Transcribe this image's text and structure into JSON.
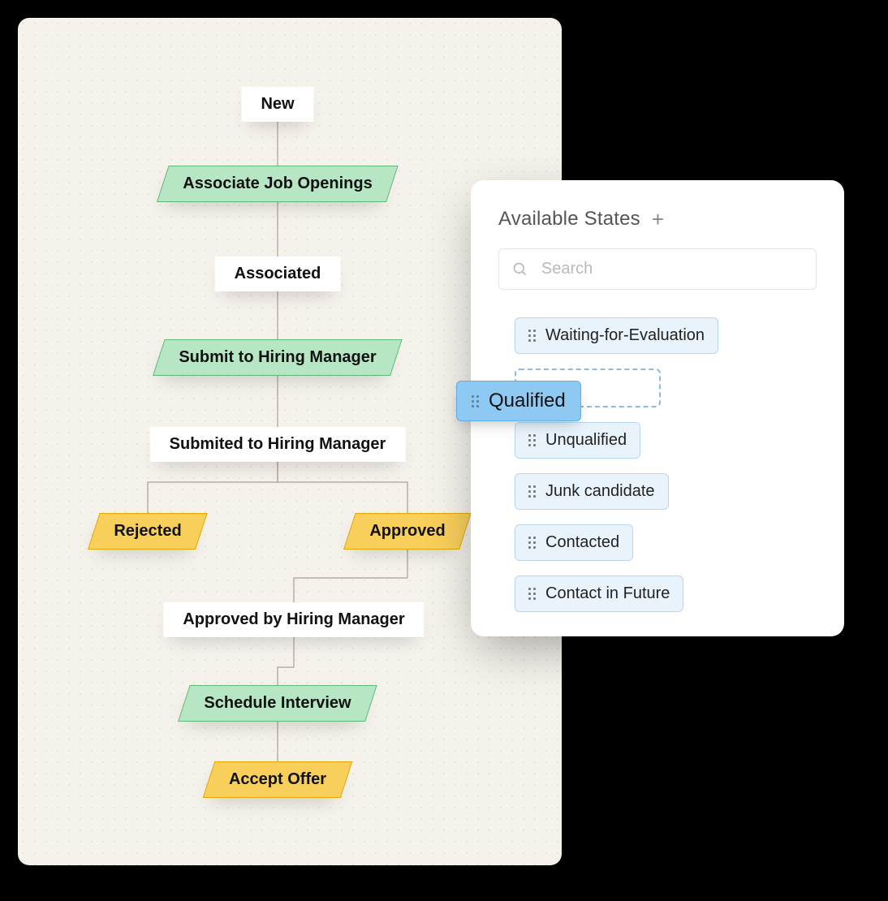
{
  "flow": {
    "new": "New",
    "assoc_open": "Associate Job Openings",
    "associated": "Associated",
    "submit": "Submit to Hiring Manager",
    "submitted": "Submited to Hiring Manager",
    "rejected": "Rejected",
    "approved": "Approved",
    "approved_by": "Approved by Hiring Manager",
    "schedule": "Schedule Interview",
    "accept": "Accept Offer"
  },
  "panel": {
    "title": "Available States",
    "search_placeholder": "Search",
    "drag_label": "Qualified",
    "states": {
      "s0": "Waiting-for-Evaluation",
      "s2": "Unqualified",
      "s3": "Junk candidate",
      "s4": "Contacted",
      "s5": "Contact in Future"
    }
  }
}
